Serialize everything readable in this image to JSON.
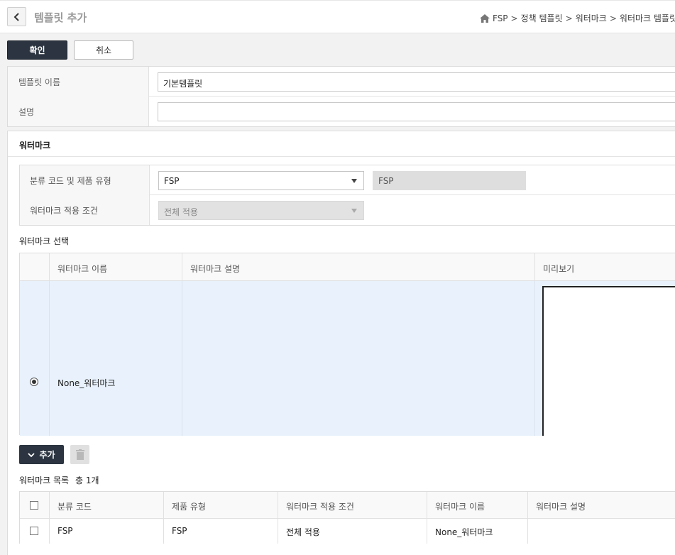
{
  "header": {
    "title": "템플릿 추가",
    "breadcrumb": [
      "FSP",
      "정책 템플릿",
      "워터마크",
      "워터마크 템플릿",
      "템플"
    ]
  },
  "actions": {
    "confirm": "확인",
    "cancel": "취소"
  },
  "form": {
    "name_label": "템플릿 이름",
    "name_value": "기본템플릿",
    "desc_label": "설명",
    "desc_value": ""
  },
  "watermark": {
    "section_title": "워터마크",
    "category_label": "분류 코드 및 제품 유형",
    "category_value": "FSP",
    "category_readonly": "FSP",
    "condition_label": "워터마크 적용 조건",
    "condition_value": "전체 적용",
    "select_title": "워터마크 선택",
    "grid_headers": [
      "워터마크 이름",
      "워터마크 설명",
      "미리보기"
    ],
    "grid_rows": [
      {
        "name": "None_워터마크",
        "description": "",
        "selected": true
      }
    ],
    "add_label": "추가",
    "list_title": "워터마크 목록",
    "list_count": "총 1개",
    "list_headers": [
      "분류 코드",
      "제품 유형",
      "워터마크 적용 조건",
      "워터마크 이름",
      "워터마크 설명"
    ],
    "list_rows": [
      [
        "FSP",
        "FSP",
        "전체 적용",
        "None_워터마크",
        ""
      ]
    ]
  },
  "icons": [
    "chevron-left-icon",
    "home-icon",
    "chevron-down-icon",
    "trash-icon"
  ],
  "colors": {
    "dark_button": "#2b3440",
    "selected_row": "#e8f1fc"
  }
}
